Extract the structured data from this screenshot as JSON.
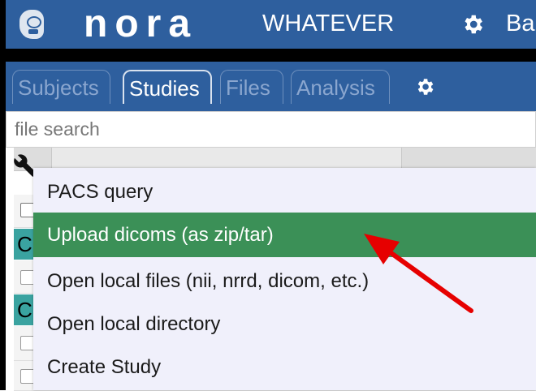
{
  "header": {
    "brand": "nora",
    "project": "WHATEVER",
    "user": "Ba"
  },
  "tabs": [
    {
      "label": "Subjects",
      "active": false
    },
    {
      "label": "Studies",
      "active": true
    },
    {
      "label": "Files",
      "active": false
    },
    {
      "label": "Analysis",
      "active": false
    }
  ],
  "search": {
    "placeholder": "file search",
    "value": ""
  },
  "menu": {
    "items": [
      {
        "label": "PACS query",
        "highlighted": false
      },
      {
        "label": "Upload dicoms (as zip/tar)",
        "highlighted": true
      },
      {
        "label": "Open local files (nii, nrrd, dicom, etc.)",
        "highlighted": false
      },
      {
        "label": "Open local directory",
        "highlighted": false
      },
      {
        "label": "Create Study",
        "highlighted": false
      }
    ]
  },
  "rows": {
    "partial_text_1": "C",
    "partial_text_2": "C"
  },
  "colors": {
    "header_bg": "#2e5f9e",
    "highlight": "#3b9057",
    "teal_row": "#3aa3a0",
    "menu_bg": "#f0f0fb",
    "annotation_arrow": "#e60000"
  },
  "icons": [
    "brain-logo-icon",
    "gear-icon",
    "wrench-icon",
    "red-arrow-annotation"
  ]
}
